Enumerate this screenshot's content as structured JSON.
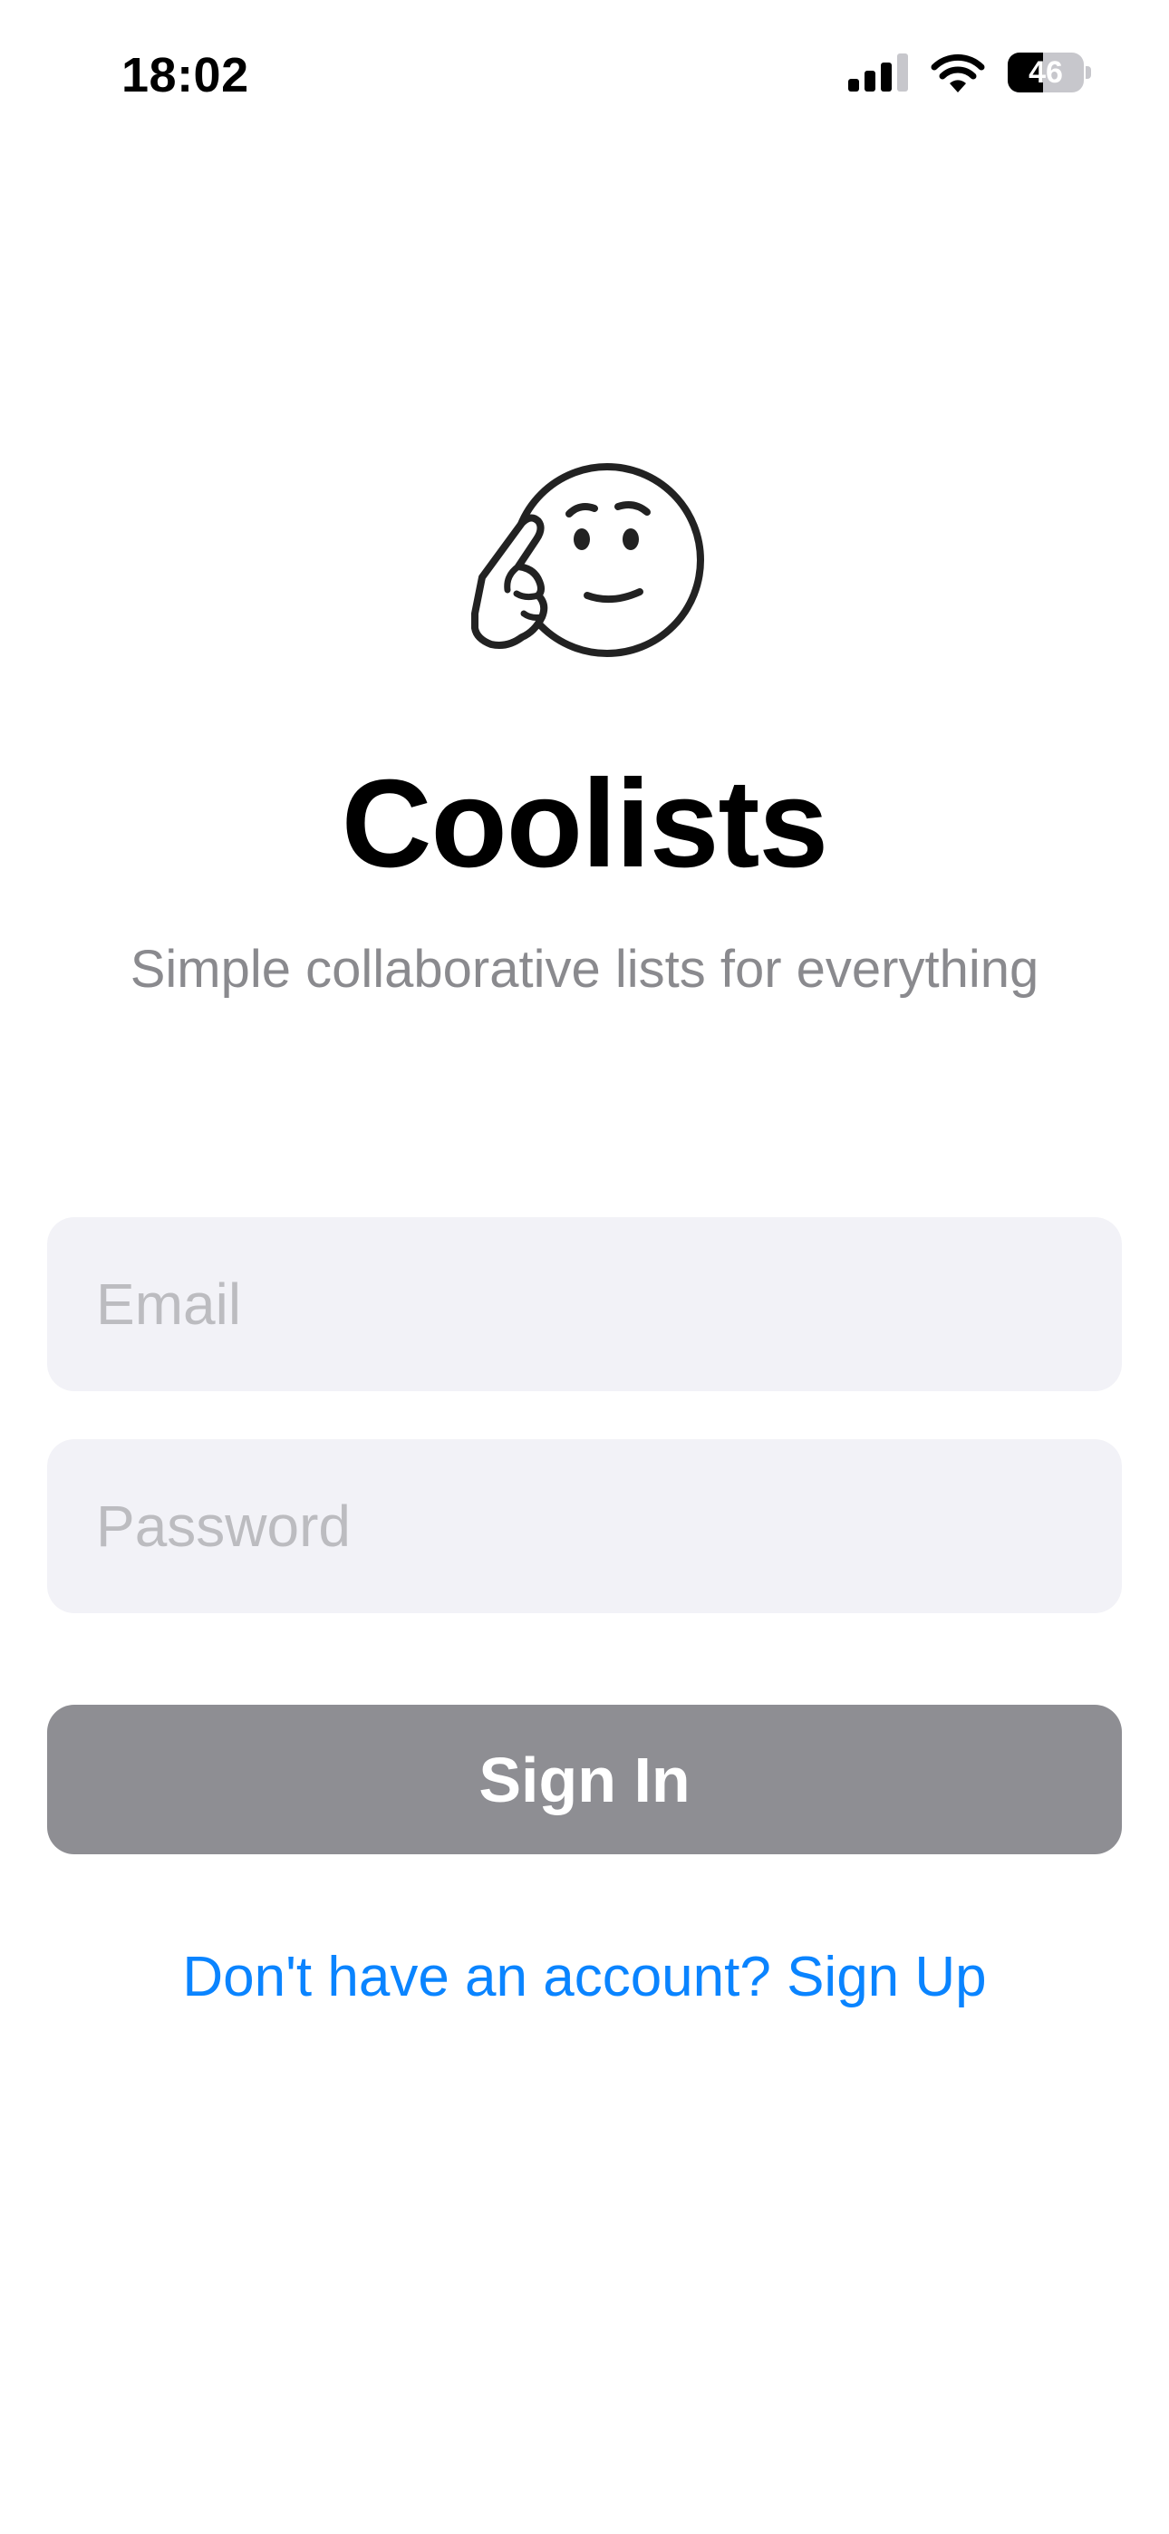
{
  "status_bar": {
    "time": "18:02",
    "battery": "46",
    "battery_level": 0.46,
    "icons": [
      "cellular-signal-icon",
      "wifi-icon",
      "battery-icon"
    ]
  },
  "app": {
    "logo_icon": "thinking-face-icon",
    "title": "Coolists",
    "subtitle": "Simple collaborative lists for everything"
  },
  "form": {
    "email_placeholder": "Email",
    "email_value": "",
    "password_placeholder": "Password",
    "password_value": "",
    "sign_in_label": "Sign In",
    "sign_up_link": "Don't have an account? Sign Up"
  },
  "colors": {
    "button_disabled": "#8e8e93",
    "field_background": "#f2f2f7",
    "link": "#0a84ff",
    "subtitle": "#8a8a8e"
  }
}
